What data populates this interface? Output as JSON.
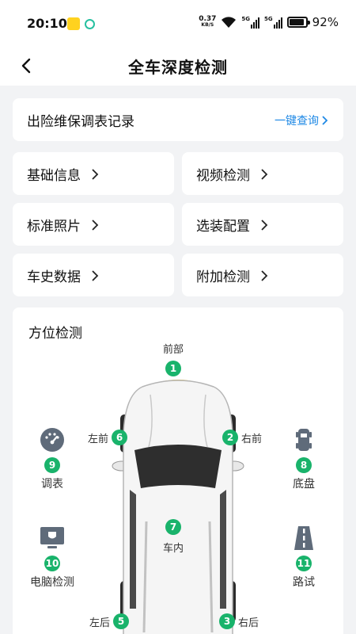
{
  "status_bar": {
    "time": "20:10",
    "net_speed": "0.37",
    "net_unit": "KB/S",
    "signal1": "5G",
    "signal2": "5G",
    "battery_pct": "92%",
    "battery_level": 0.92
  },
  "nav": {
    "title": "全车深度检测"
  },
  "record": {
    "title": "出险维保调表记录",
    "link": "一键查询"
  },
  "tiles": [
    {
      "label": "基础信息"
    },
    {
      "label": "视频检测"
    },
    {
      "label": "标准照片"
    },
    {
      "label": "选装配置"
    },
    {
      "label": "车史数据"
    },
    {
      "label": "附加检测"
    }
  ],
  "direction": {
    "title": "方位检测",
    "points": {
      "front": {
        "num": "1",
        "label": "前部"
      },
      "right_front": {
        "num": "2",
        "label": "右前"
      },
      "right_rear": {
        "num": "3",
        "label": "右后"
      },
      "left_rear": {
        "num": "5",
        "label": "左后"
      },
      "left_front": {
        "num": "6",
        "label": "左前"
      },
      "interior": {
        "num": "7",
        "label": "车内"
      }
    },
    "side_items": {
      "meter": {
        "num": "9",
        "label": "调表"
      },
      "chassis": {
        "num": "8",
        "label": "底盘"
      },
      "computer": {
        "num": "10",
        "label": "电脑检测"
      },
      "road": {
        "num": "11",
        "label": "路试"
      }
    }
  },
  "colors": {
    "accent_blue": "#1e88e5",
    "badge_green": "#19b36b",
    "background": "#f2f3f5"
  }
}
